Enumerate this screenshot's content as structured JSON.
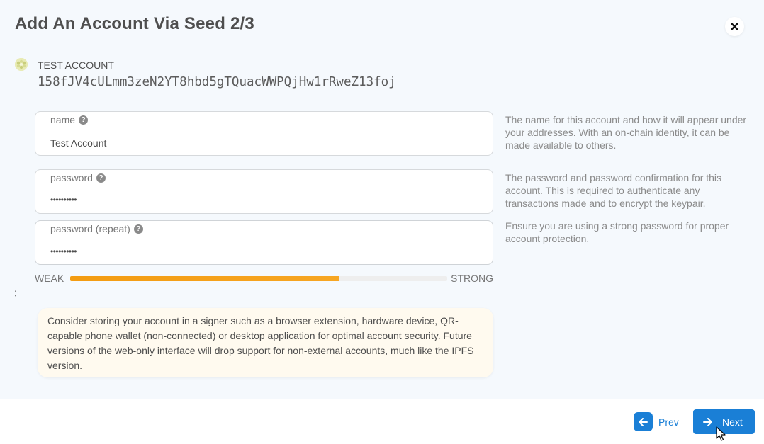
{
  "modal": {
    "title": "Add An Account Via Seed 2/3",
    "close_label": "×"
  },
  "account": {
    "name": "TEST ACCOUNT",
    "address": "158fJV4cULmm3zeN2YT8hbd5gTQuacWWPQjHw1rRweZ13foj"
  },
  "form": {
    "name": {
      "label": "name",
      "value": "Test Account",
      "help": "The name for this account and how it will appear under your addresses. With an on-chain identity, it can be made available to others."
    },
    "password": {
      "label": "password",
      "value": "••••••••••",
      "help": "The password and password confirmation for this account. This is required to authenticate any transactions made and to encrypt the keypair."
    },
    "password_repeat": {
      "label": "password (repeat)",
      "value": "••••••••••",
      "help": "Ensure you are using a strong password for proper account protection."
    }
  },
  "strength": {
    "weak_label": "WEAK",
    "strong_label": "STRONG",
    "level": 0.715,
    "color": "#f39c12"
  },
  "stray_text": ";",
  "warning": {
    "text": "Consider storing your account in a signer such as a browser extension, hardware device, QR-capable phone wallet (non-connected) or desktop application for optimal account security. Future versions of the web-only interface will drop support for non-external accounts, much like the IPFS version."
  },
  "actions": {
    "prev_label": "Prev",
    "next_label": "Next"
  },
  "colors": {
    "accent": "#1a7fd6",
    "body_bg": "#f5f9fd",
    "warning_bg": "#fffaef"
  }
}
